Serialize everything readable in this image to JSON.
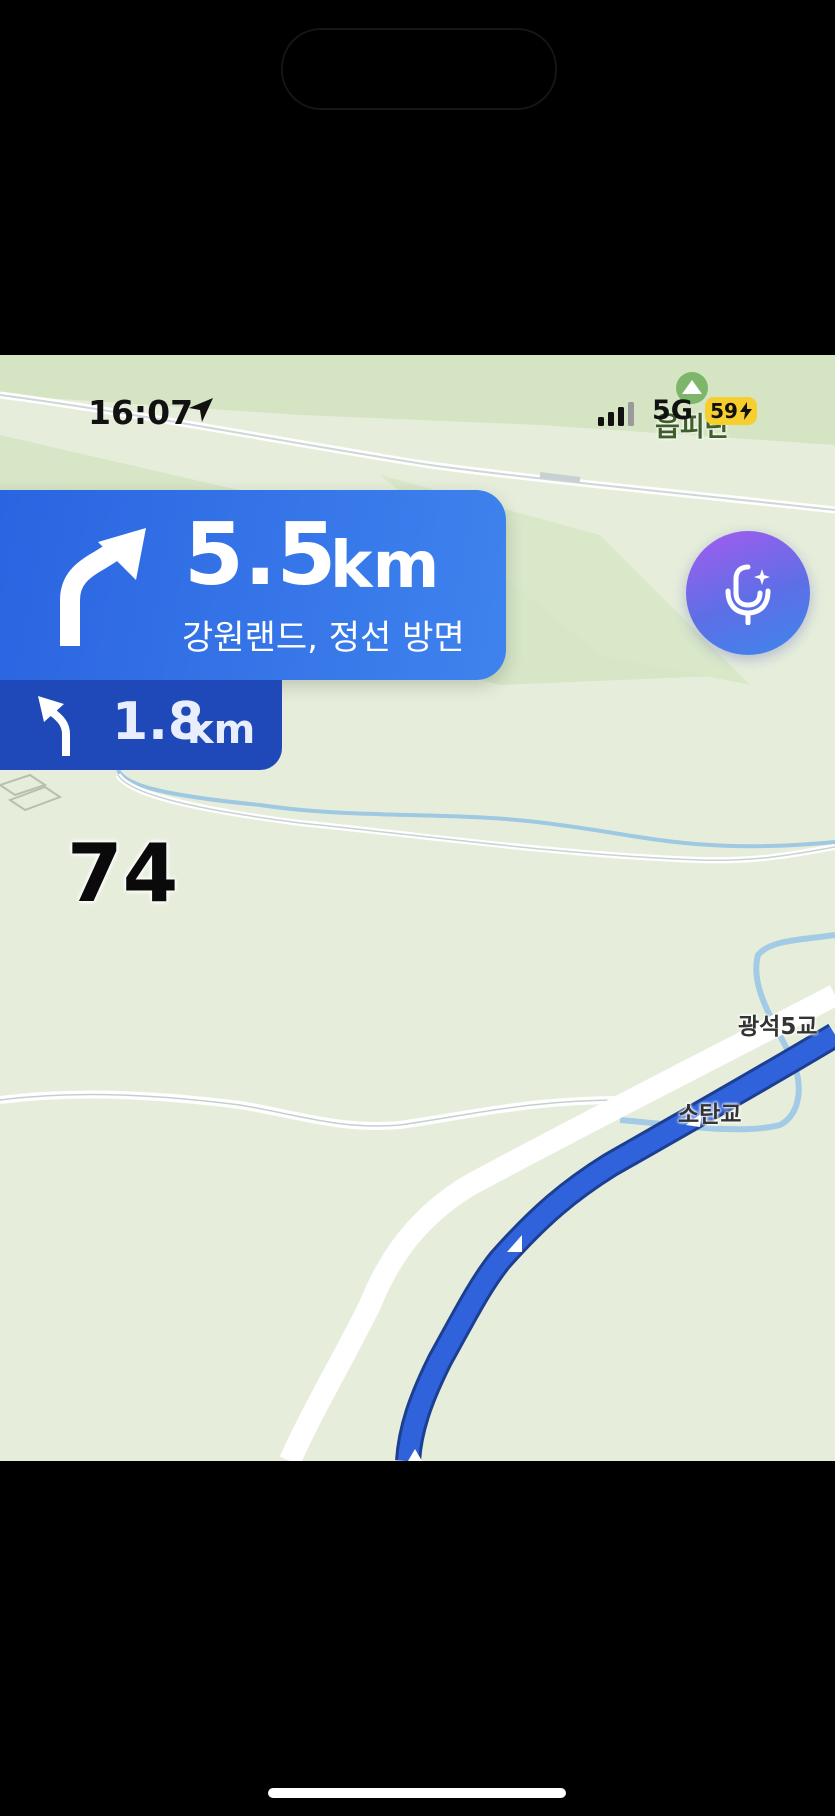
{
  "status_bar": {
    "time": "16:07",
    "network": "5G",
    "battery": "59"
  },
  "map": {
    "poi_label": "읍피란",
    "places": [
      "광석5교",
      "소탄교"
    ]
  },
  "navigation": {
    "main_distance": "5.5",
    "main_unit": "km",
    "main_direction": "강원랜드, 정선 방면",
    "main_turn_icon": "turn-slight-right-icon",
    "next_distance": "1.8",
    "next_unit": "km",
    "next_turn_icon": "turn-slight-left-icon"
  },
  "speed": "74",
  "colors": {
    "route": "#2f62db",
    "nav_main": "#2f6be6",
    "nav_next": "#1f49b8",
    "map_bg": "#e6eedb"
  }
}
